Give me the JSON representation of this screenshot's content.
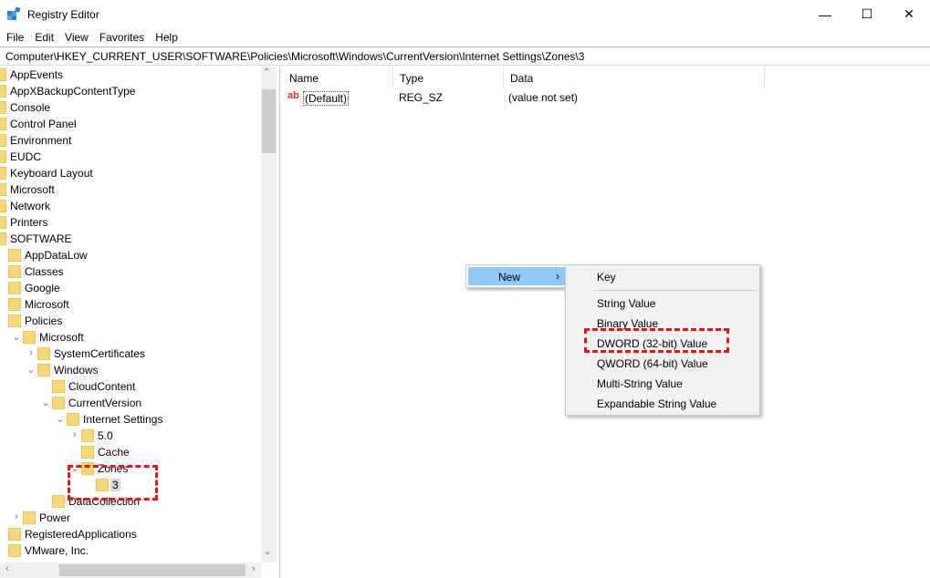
{
  "window": {
    "title": "Registry Editor",
    "minimize": "—",
    "maximize": "☐",
    "close": "✕"
  },
  "menu": [
    "File",
    "Edit",
    "View",
    "Favorites",
    "Help"
  ],
  "address": "Computer\\HKEY_CURRENT_USER\\SOFTWARE\\Policies\\Microsoft\\Windows\\CurrentVersion\\Internet Settings\\Zones\\3",
  "tree": [
    {
      "label": "AppEvents",
      "depth": 0,
      "exp": ""
    },
    {
      "label": "AppXBackupContentType",
      "depth": 0,
      "exp": ""
    },
    {
      "label": "Console",
      "depth": 0,
      "exp": ""
    },
    {
      "label": "Control Panel",
      "depth": 0,
      "exp": ""
    },
    {
      "label": "Environment",
      "depth": 0,
      "exp": ""
    },
    {
      "label": "EUDC",
      "depth": 0,
      "exp": ""
    },
    {
      "label": "Keyboard Layout",
      "depth": 0,
      "exp": ""
    },
    {
      "label": "Microsoft",
      "depth": 0,
      "exp": ""
    },
    {
      "label": "Network",
      "depth": 0,
      "exp": ""
    },
    {
      "label": "Printers",
      "depth": 0,
      "exp": ""
    },
    {
      "label": "SOFTWARE",
      "depth": 0,
      "exp": ""
    },
    {
      "label": "AppDataLow",
      "depth": 1,
      "exp": ""
    },
    {
      "label": "Classes",
      "depth": 1,
      "exp": ""
    },
    {
      "label": "Google",
      "depth": 1,
      "exp": ""
    },
    {
      "label": "Microsoft",
      "depth": 1,
      "exp": ""
    },
    {
      "label": "Policies",
      "depth": 1,
      "exp": ""
    },
    {
      "label": "Microsoft",
      "depth": 2,
      "exp": "open"
    },
    {
      "label": "SystemCertificates",
      "depth": 3,
      "exp": "closed"
    },
    {
      "label": "Windows",
      "depth": 3,
      "exp": "open"
    },
    {
      "label": "CloudContent",
      "depth": 4,
      "exp": ""
    },
    {
      "label": "CurrentVersion",
      "depth": 4,
      "exp": "open"
    },
    {
      "label": "Internet Settings",
      "depth": 5,
      "exp": "open"
    },
    {
      "label": "5.0",
      "depth": 6,
      "exp": "closed"
    },
    {
      "label": "Cache",
      "depth": 6,
      "exp": ""
    },
    {
      "label": "Zones",
      "depth": 6,
      "exp": "open"
    },
    {
      "label": "3",
      "depth": 7,
      "exp": "",
      "selected": true
    },
    {
      "label": "DataCollection",
      "depth": 4,
      "exp": ""
    },
    {
      "label": "Power",
      "depth": 2,
      "exp": "closed"
    },
    {
      "label": "RegisteredApplications",
      "depth": 1,
      "exp": ""
    },
    {
      "label": "VMware, Inc.",
      "depth": 1,
      "exp": ""
    }
  ],
  "list": {
    "headers": [
      "Name",
      "Type",
      "Data"
    ],
    "rows": [
      {
        "name": "(Default)",
        "type": "REG_SZ",
        "data": "(value not set)",
        "icon": "ab"
      }
    ]
  },
  "context_menu": {
    "new": "New",
    "arrow": "›",
    "items": [
      "Key",
      "String Value",
      "Binary Value",
      "DWORD (32-bit) Value",
      "QWORD (64-bit) Value",
      "Multi-String Value",
      "Expandable String Value"
    ]
  },
  "colors": {
    "highlight": "#91c9f7",
    "annotation": "#e8141b"
  }
}
